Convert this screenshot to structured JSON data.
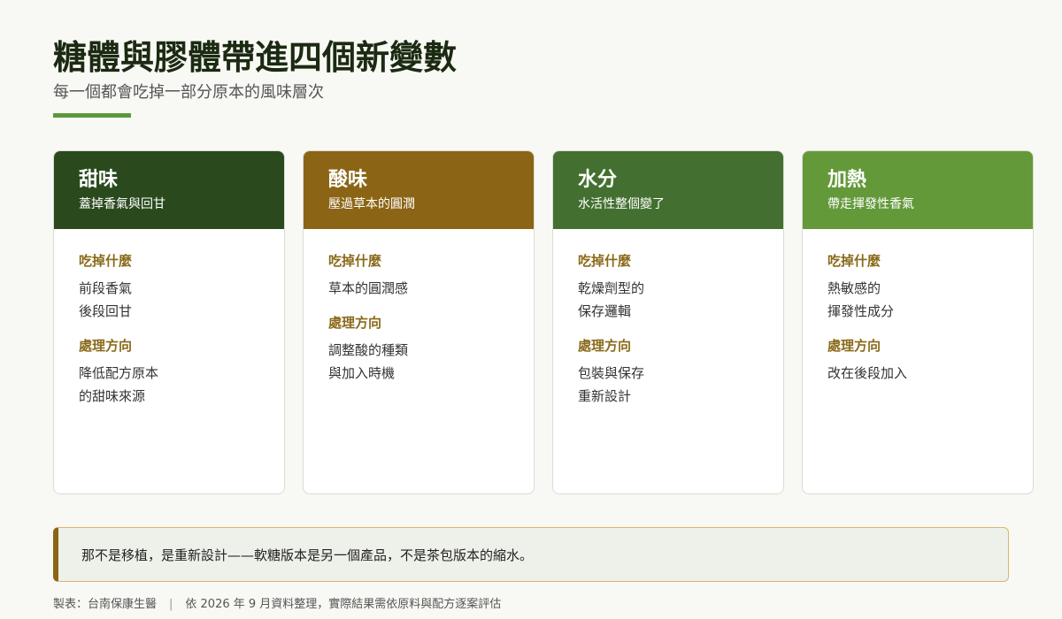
{
  "title": "糖體與膠體帶進四個新變數",
  "subtitle": "每一個都會吃掉一部分原本的風味層次",
  "colors": {
    "accent_rule": "#5a9a3a",
    "label": "#8a6a1a",
    "callout_bar": "#8b6514",
    "callout_border": "#d9b870"
  },
  "cards": [
    {
      "title": "甜味",
      "subtitle": "蓋掉香氣與回甘",
      "color": "#2a4a1e",
      "section1_label": "吃掉什麼",
      "section1_lines": [
        "前段香氣",
        "後段回甘"
      ],
      "section2_label": "處理方向",
      "section2_lines": [
        "降低配方原本",
        "的甜味來源"
      ]
    },
    {
      "title": "酸味",
      "subtitle": "壓過草本的圓潤",
      "color": "#8b6515",
      "section1_label": "吃掉什麼",
      "section1_lines": [
        "草本的圓潤感"
      ],
      "section2_label": "處理方向",
      "section2_lines": [
        "調整酸的種類",
        "與加入時機"
      ]
    },
    {
      "title": "水分",
      "subtitle": "水活性整個變了",
      "color": "#437030",
      "section1_label": "吃掉什麼",
      "section1_lines": [
        "乾燥劑型的",
        "保存邏輯"
      ],
      "section2_label": "處理方向",
      "section2_lines": [
        "包裝與保存",
        "重新設計"
      ]
    },
    {
      "title": "加熱",
      "subtitle": "帶走揮發性香氣",
      "color": "#64993a",
      "section1_label": "吃掉什麼",
      "section1_lines": [
        "熱敏感的",
        "揮發性成分"
      ],
      "section2_label": "處理方向",
      "section2_lines": [
        "改在後段加入"
      ]
    }
  ],
  "callout": "那不是移植，是重新設計——軟糖版本是另一個產品，不是茶包版本的縮水。",
  "footer": {
    "maker": "製表：台南保康生醫",
    "separator": "|",
    "note": "依 2026 年 9 月資料整理，實際結果需依原料與配方逐案評估"
  }
}
